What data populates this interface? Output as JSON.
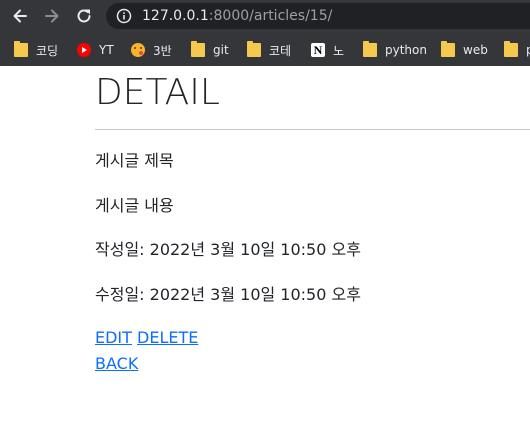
{
  "browser": {
    "url_host": "127.0.0.1",
    "url_rest": ":8000/articles/15/",
    "bookmarks": [
      {
        "icon": "folder-icon",
        "label": "코딩"
      },
      {
        "icon": "youtube-icon",
        "label": "YT"
      },
      {
        "icon": "emoji-icon",
        "label": "3반"
      },
      {
        "icon": "folder-icon",
        "label": "git"
      },
      {
        "icon": "folder-icon",
        "label": "코테"
      },
      {
        "icon": "notion-icon",
        "label": "노"
      },
      {
        "icon": "folder-icon",
        "label": "python"
      },
      {
        "icon": "folder-icon",
        "label": "web"
      },
      {
        "icon": "folder-icon",
        "label": "p"
      }
    ]
  },
  "page": {
    "title": "DETAIL",
    "article_title": "게시글 제목",
    "article_content": "게시글 내용",
    "created": "작성일: 2022년 3월 10일 10:50 오후",
    "updated": "수정일: 2022년 3월 10일 10:50 오후",
    "edit_label": "EDIT",
    "delete_label": "DELETE",
    "back_label": "BACK"
  },
  "colors": {
    "chrome": "#35363a",
    "omnibox": "#202124",
    "link": "#0d6efd",
    "text": "#212529"
  }
}
